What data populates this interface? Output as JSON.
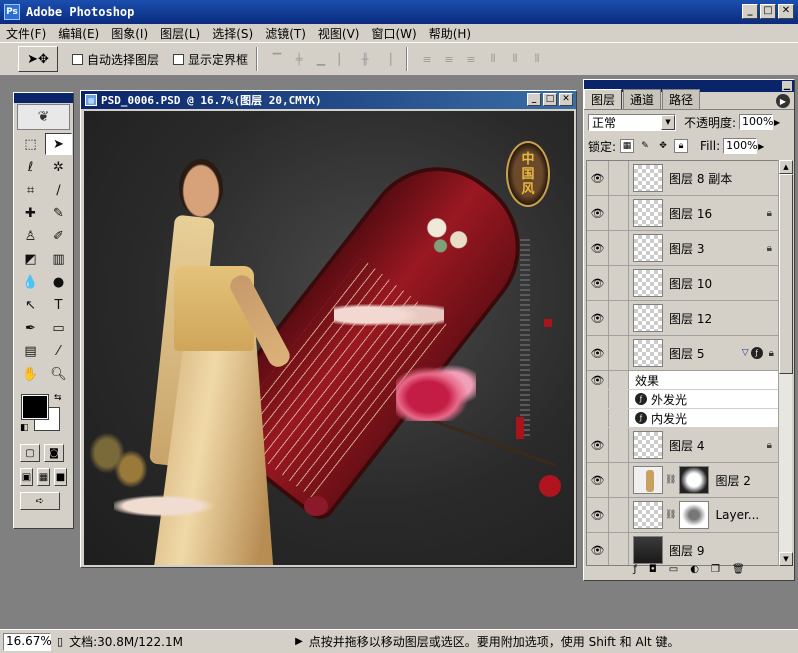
{
  "window": {
    "title": "Adobe Photoshop",
    "minimize": "_",
    "maximize": "□",
    "close": "✕"
  },
  "menu": [
    "文件(F)",
    "编辑(E)",
    "图象(I)",
    "图层(L)",
    "选择(S)",
    "滤镜(T)",
    "视图(V)",
    "窗口(W)",
    "帮助(H)"
  ],
  "options": {
    "auto_select_label": "自动选择图层",
    "show_bounds_label": "显示定界框"
  },
  "document": {
    "title": "PSD_0006.PSD @ 16.7%(图层 20,CMYK)",
    "seal_text": [
      "中",
      "国",
      "风"
    ]
  },
  "layers_panel": {
    "tabs": [
      "图层",
      "通道",
      "路径"
    ],
    "blend_mode": "正常",
    "opacity_label": "不透明度:",
    "opacity_value": "100%",
    "lock_label": "锁定:",
    "fill_label": "Fill:",
    "fill_value": "100%",
    "layers": [
      {
        "name": "图层 8 副本",
        "thumb": "transparent",
        "locked": false
      },
      {
        "name": "图层 16",
        "thumb": "transparent",
        "locked": true
      },
      {
        "name": "图层 3",
        "thumb": "transparent",
        "locked": true
      },
      {
        "name": "图层 10",
        "thumb": "transparent",
        "locked": false
      },
      {
        "name": "图层 12",
        "thumb": "transparent",
        "locked": false
      },
      {
        "name": "图层 5",
        "thumb": "transparent",
        "locked": true,
        "has_effects": true
      },
      {
        "name": "图层 4",
        "thumb": "transparent",
        "locked": true
      },
      {
        "name": "图层 2",
        "thumb": "woman",
        "mask": "radial",
        "locked": false
      },
      {
        "name": "Layer...",
        "thumb": "transparent",
        "mask": "blur",
        "locked": false
      },
      {
        "name": "图层 9",
        "thumb": "dark",
        "locked": false
      }
    ],
    "effects_label": "效果",
    "effects": [
      "外发光",
      "内发光"
    ]
  },
  "statusbar": {
    "zoom": "16.67%",
    "doc_size": "文档:30.8M/122.1M",
    "hint": "点按并拖移以移动图层或选区。要用附加选项，使用 Shift 和 Alt 键。"
  }
}
